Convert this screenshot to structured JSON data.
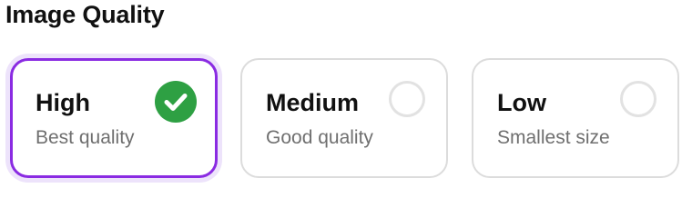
{
  "section": {
    "title": "Image Quality"
  },
  "options": [
    {
      "label": "High",
      "description": "Best quality",
      "selected": true
    },
    {
      "label": "Medium",
      "description": "Good quality",
      "selected": false
    },
    {
      "label": "Low",
      "description": "Smallest size",
      "selected": false
    }
  ],
  "colors": {
    "selected_border": "#8a2be2",
    "selected_glow": "#ede3fb",
    "check": "#2ea043",
    "card_border": "#dcdcdc",
    "radio_border": "#e2e2e2",
    "subtext": "#6f6f6f"
  },
  "icons": {
    "selected_indicator": "check-circle-icon",
    "unselected_indicator": "radio-empty-icon"
  }
}
